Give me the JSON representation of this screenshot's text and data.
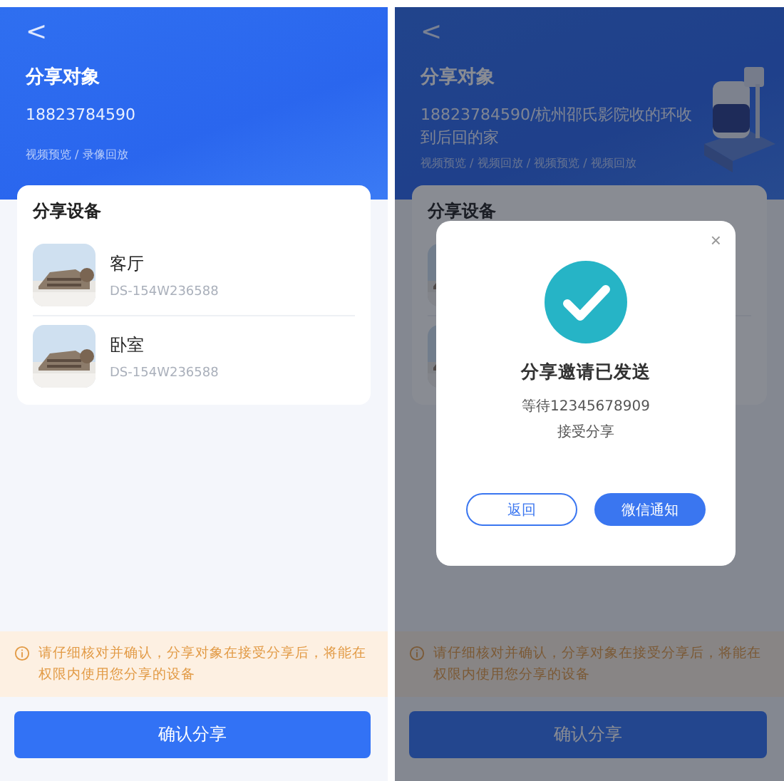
{
  "screens": [
    {
      "kind": "form",
      "back": "<",
      "target_title": "分享对象",
      "target": "18823784590",
      "permissions": "视频预览 / 录像回放",
      "device_card": {
        "title": "分享设备",
        "devices": [
          {
            "kind": "device",
            "name": "客厅",
            "serial": "DS-154W236588"
          },
          {
            "kind": "device",
            "name": "卧室",
            "serial": "DS-154W236588"
          }
        ]
      },
      "notice": "请仔细核对并确认，分享对象在接受分享后，将能在权限内使用您分享的设备",
      "confirm": "确认分享"
    },
    {
      "kind": "dialog",
      "back": "<",
      "target_title": "分享对象",
      "target": "18823784590/杭州邵氏影院收的环收到后回的家",
      "permissions": "视频预览 / 视频回放 / 视频预览 / 视频回放",
      "device_card": {
        "title": "分享设备"
      },
      "notice": "请仔细核对并确认，分享对象在接受分享后，将能在权限内使用您分享的设备",
      "confirm": "确认分享",
      "dialog": {
        "close": "×",
        "title": "分享邀请已发送",
        "message": "等待12345678909",
        "message_2": "接受分享",
        "buttons": [
          {
            "kind": "outline",
            "label": "返回"
          },
          {
            "kind": "primary",
            "label": "微信通知"
          }
        ]
      }
    }
  ]
}
